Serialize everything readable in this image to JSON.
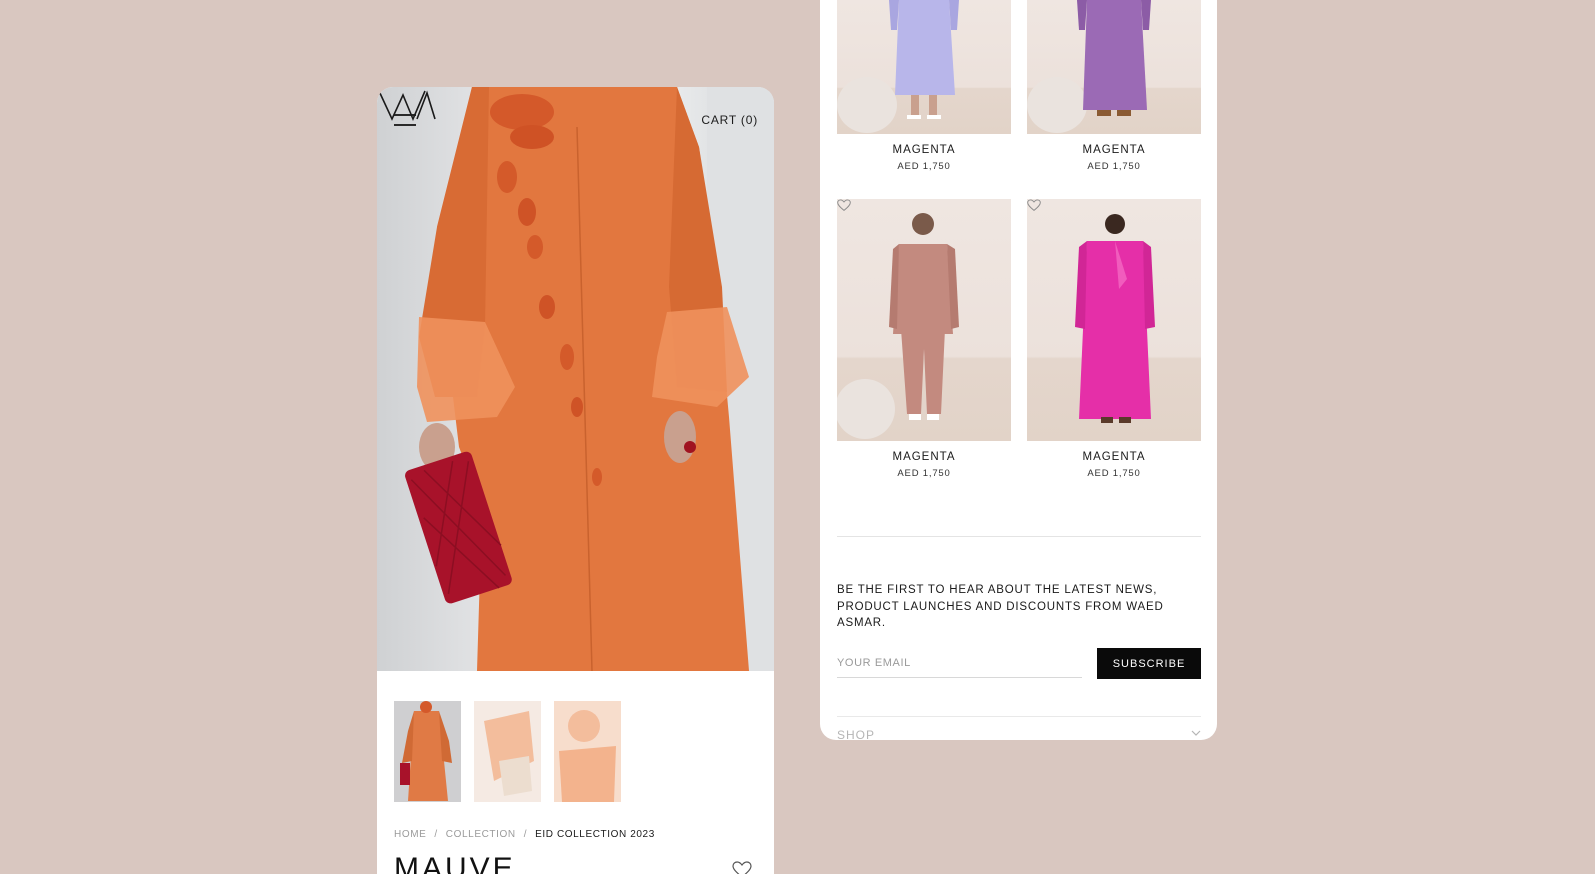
{
  "product_page": {
    "header": {
      "menu_icon": "hamburger-menu-icon",
      "logo_icon": "waed-asmar-monogram-icon",
      "cart_label": "CART (0)"
    },
    "hero_image": "orange-abaya-with-red-clutch",
    "thumbnails": [
      {
        "image": "orange-abaya-full-length"
      },
      {
        "image": "orange-abaya-detail-sleeve"
      },
      {
        "image": "orange-abaya-detail-flower"
      }
    ],
    "breadcrumb": {
      "items": [
        "HOME",
        "COLLECTION",
        "EID COLLECTION 2023"
      ],
      "separator": "/"
    },
    "title": "MAUVE",
    "wishlist_icon": "heart-outline-icon"
  },
  "listing_page": {
    "products": [
      {
        "name": "MAGENTA",
        "price": "AED 1,750",
        "color": "#b8b6ea"
      },
      {
        "name": "MAGENTA",
        "price": "AED 1,750",
        "color": "#9b6ab5"
      },
      {
        "name": "MAGENTA",
        "price": "AED 1,750",
        "color": "#c38a7f"
      },
      {
        "name": "MAGENTA",
        "price": "AED 1,750",
        "color": "#e52fa8"
      }
    ],
    "newsletter": {
      "text": "BE THE FIRST TO HEAR ABOUT THE LATEST NEWS, PRODUCT LAUNCHES AND DISCOUNTS FROM WAED ASMAR.",
      "email_placeholder": "YOUR EMAIL",
      "email_value": "",
      "subscribe_label": "SUBSCRIBE"
    },
    "footer_accordion": {
      "shop_label": "SHOP",
      "icon": "chevron-down-icon"
    }
  },
  "colors": {
    "page_background": "#d9c7c0",
    "button_background": "#0a0a0a",
    "accent_orange": "#e07a45"
  }
}
